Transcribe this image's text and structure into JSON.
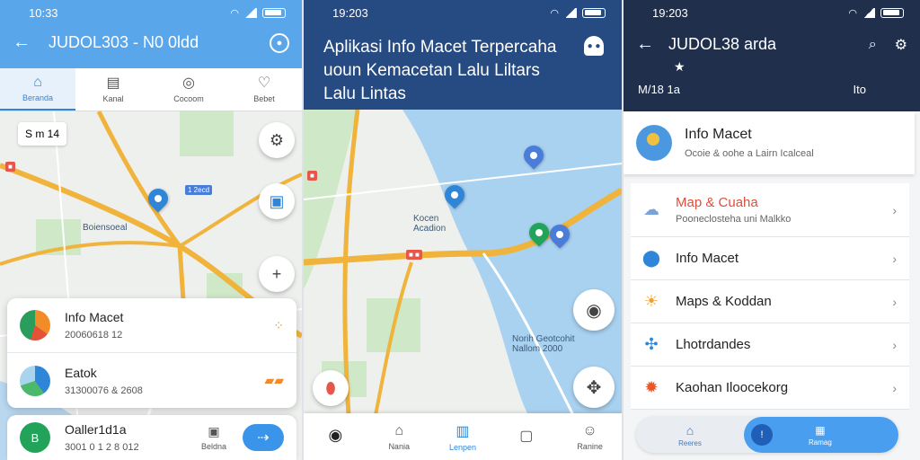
{
  "screen1": {
    "status_time": "10:33",
    "title": "JUDOL303 - N0 0ldd",
    "tabs": [
      {
        "label": "Beranda",
        "icon": "home-icon"
      },
      {
        "label": "Kanal",
        "icon": "list-icon"
      },
      {
        "label": "Cocoom",
        "icon": "compass-icon"
      },
      {
        "label": "Bebet",
        "icon": "heart-icon"
      }
    ],
    "scale_chip": "S m 14",
    "map_labels": {
      "west": "Boiensoeal",
      "tag": "1 2ecd"
    },
    "cards": [
      {
        "title": "Info Macet",
        "sub": "20060618 12"
      },
      {
        "title": "Eatok",
        "sub": "31300076 & 2608"
      }
    ],
    "bottom": {
      "title": "Oaller1d1a",
      "sub": "3001 0 1 2 8 012",
      "tab_label": "Beldna",
      "icon_letter": "B"
    }
  },
  "screen2": {
    "status_time": "19:203",
    "title": "Aplikasi Info Macet Terpercaha uoun Kemacetan Lalu Liltars Lalu Lintas",
    "map_labels": {
      "north": "Kocen Acadion",
      "south": "Norih Geotcohit Nallom 2000"
    },
    "nav": [
      {
        "label": "",
        "icon": "target-icon"
      },
      {
        "label": "Nania",
        "icon": "home-outline-icon"
      },
      {
        "label": "Lenpen",
        "icon": "building-icon"
      },
      {
        "label": "",
        "icon": "square-icon"
      },
      {
        "label": "Ranine",
        "icon": "person-icon"
      }
    ]
  },
  "screen3": {
    "status_time": "19:203",
    "title": "JUDOL38 arda",
    "subtitle_left": "M/18 1a",
    "subtitle_right": "Ito",
    "info": {
      "title": "Info Macet",
      "sub": "Ocoie & oohe a Lairn Icalceal"
    },
    "menu": [
      {
        "label": "Map & Cuaha",
        "sub": "Pooneclosteha uni Malkko",
        "icon": "weather-icon",
        "highlight": true
      },
      {
        "label": "Info Macet",
        "sub": "",
        "icon": "location-pin-icon",
        "highlight": false
      },
      {
        "label": "Maps & Koddan",
        "sub": "",
        "icon": "cloud-sun-icon",
        "highlight": false
      },
      {
        "label": "Lhotrdandes",
        "sub": "",
        "icon": "sparkle-icon",
        "highlight": false
      },
      {
        "label": "Kaohan Iloocekorg",
        "sub": "",
        "icon": "sun-icon",
        "highlight": false
      }
    ],
    "bottom": {
      "left_label": "Reeres",
      "right_label": "Ramag"
    }
  },
  "colors": {
    "blue_header": "#5aa6ea",
    "navy_header": "#264a82",
    "dark_header": "#1f2f4c",
    "accent": "#2f86d8",
    "route": "#f0b33c"
  }
}
